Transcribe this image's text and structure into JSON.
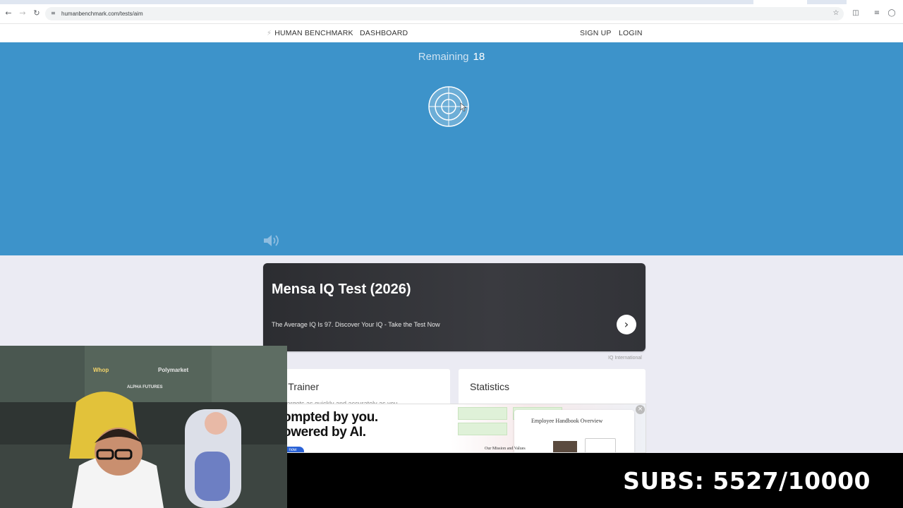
{
  "browser": {
    "url": "humanbenchmark.com/tests/aim",
    "back_icon": "arrow-left-icon",
    "forward_icon": "arrow-right-icon",
    "reload_icon": "reload-icon"
  },
  "nav": {
    "brand": "HUMAN BENCHMARK",
    "dashboard": "DASHBOARD",
    "signup": "SIGN UP",
    "login": "LOGIN"
  },
  "test": {
    "remaining_label": "Remaining",
    "remaining_count": "18",
    "background_color": "#3d93ca"
  },
  "ad": {
    "title": "Mensa IQ Test (2026)",
    "text": "The Average IQ Is 97. Discover Your IQ - Take the Test Now",
    "source": "IQ International"
  },
  "cards": [
    {
      "title": "m Trainer",
      "faded_text": "the targets as quickly and accurately as you"
    },
    {
      "title": "Statistics"
    }
  ],
  "banner": {
    "line1": "ompted by you.",
    "line2": "owered by AI.",
    "cta": "now",
    "doc_title": "Employee Handbook Overview",
    "doc_sub": "Our Mission and Values"
  },
  "stream": {
    "subs": "SUBS: 5527/10000",
    "sponsors": [
      "Whop",
      "ALPHA FUTURES",
      "Polymarket"
    ]
  }
}
